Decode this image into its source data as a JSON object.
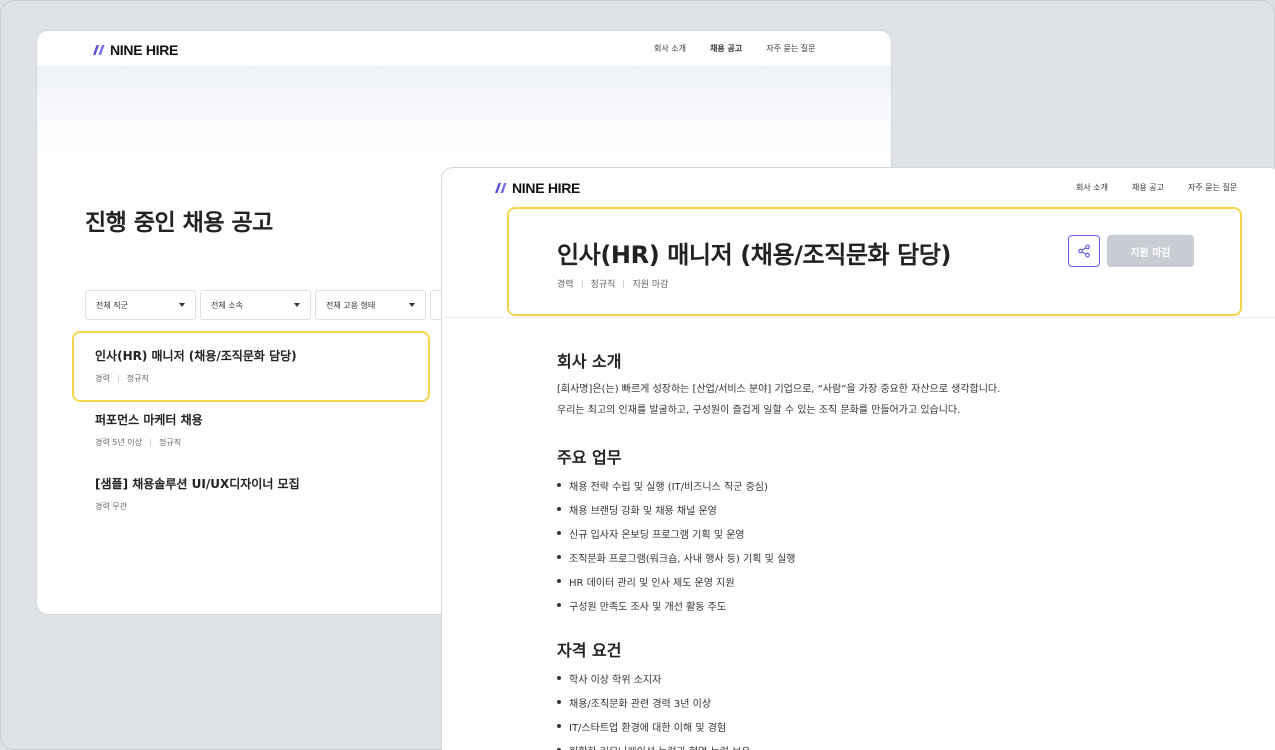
{
  "brand": {
    "logo_text": "NINE HIRE",
    "accent": "#6b5ce7",
    "highlight": "#f4d54a"
  },
  "nav": {
    "about": "회사 소개",
    "jobs": "채용 공고",
    "faq": "자주 묻는 질문"
  },
  "list_page": {
    "title": "진행 중인 채용 공고",
    "filters": [
      "전체 직군",
      "전체 소속",
      "전체 고용 형태"
    ],
    "jobs": [
      {
        "title": "인사(HR) 매니저 (채용/조직문화 담당)",
        "meta": [
          "경력",
          "정규직"
        ]
      },
      {
        "title": "퍼포먼스 마케터 채용",
        "meta": [
          "경력 5년 이상",
          "정규직"
        ]
      },
      {
        "title": "[샘플] 채용솔루션 UI/UX디자이너 모집",
        "meta": [
          "경력 무관"
        ]
      }
    ]
  },
  "detail_page": {
    "title": "인사(HR) 매니저 (채용/조직문화 담당)",
    "meta": [
      "경력",
      "정규직",
      "지원 마감"
    ],
    "share_icon": "share-icon",
    "status_button": "지원 마감",
    "about": {
      "heading": "회사 소개",
      "lines": [
        "[회사명]은(는) 빠르게 성장하는 [산업/서비스 분야] 기업으로, “사람”을 가장 중요한 자산으로 생각합니다.",
        "우리는 최고의 인재를 발굴하고, 구성원이 즐겁게 일할 수 있는 조직 문화를 만들어가고 있습니다."
      ]
    },
    "duties": {
      "heading": "주요 업무",
      "items": [
        "채용 전략 수립 및 실행 (IT/비즈니스 직군 중심)",
        "채용 브랜딩 강화 및 채용 채널 운영",
        "신규 입사자 온보딩 프로그램 기획 및 운영",
        "조직문화 프로그램(워크숍, 사내 행사 등) 기획 및 실행",
        "HR 데이터 관리 및 인사 제도 운영 지원",
        "구성원 만족도 조사 및 개선 활동 주도"
      ]
    },
    "requirements": {
      "heading": "자격 요건",
      "items": [
        "학사 이상 학위 소지자",
        "채용/조직문화 관련 경력 3년 이상",
        "IT/스타트업 환경에 대한 이해 및 경험",
        "원활한 커뮤니케이션 능력과 협업 능력 보유"
      ]
    }
  }
}
